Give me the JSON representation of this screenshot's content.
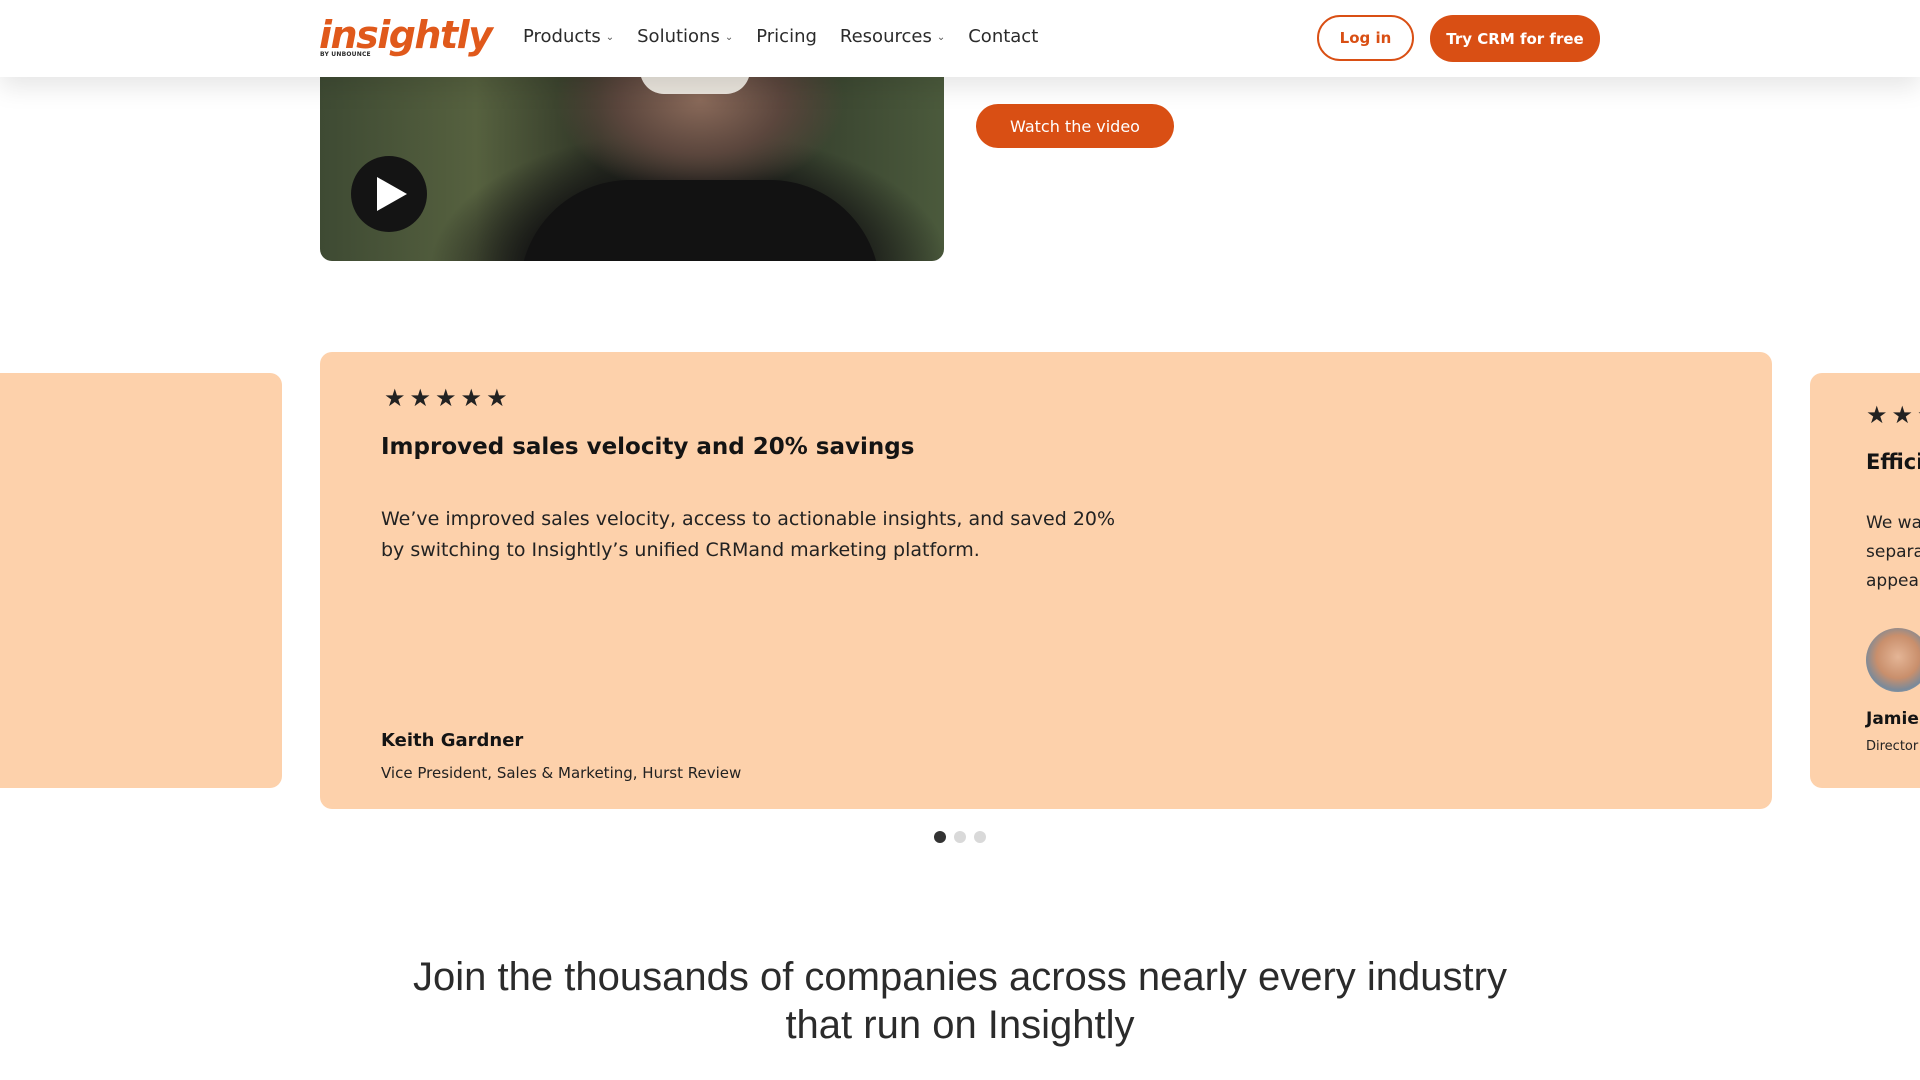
{
  "brand": {
    "logo_text": "insightly",
    "logo_sub": "BY UNBOUNCE",
    "accent_color": "#d94f14"
  },
  "nav": {
    "items": [
      {
        "label": "Products",
        "has_dropdown": true
      },
      {
        "label": "Solutions",
        "has_dropdown": true
      },
      {
        "label": "Pricing",
        "has_dropdown": false
      },
      {
        "label": "Resources",
        "has_dropdown": true
      },
      {
        "label": "Contact",
        "has_dropdown": false
      }
    ],
    "login_label": "Log in",
    "try_label": "Try CRM for free"
  },
  "video": {
    "watch_label": "Watch the video",
    "play_icon": "play-icon"
  },
  "testimonials": {
    "active": {
      "rating": 5,
      "title": "Improved sales velocity and 20% savings",
      "body": "We’ve improved sales velocity, access to actionable insights, and saved 20% by switching to Insightly’s unified CRMand marketing platform.",
      "name": "Keith Gardner",
      "role": "Vice President, Sales & Marketing, Hurst Review"
    },
    "next_partial": {
      "title": "Effici",
      "body_lines": [
        "We wa",
        "separa",
        "appea"
      ],
      "name": "Jamie",
      "role": "Director"
    },
    "dots": {
      "count": 3,
      "active_index": 0
    }
  },
  "join": {
    "heading": "Join the thousands of companies across nearly every industry that run on Insightly"
  }
}
